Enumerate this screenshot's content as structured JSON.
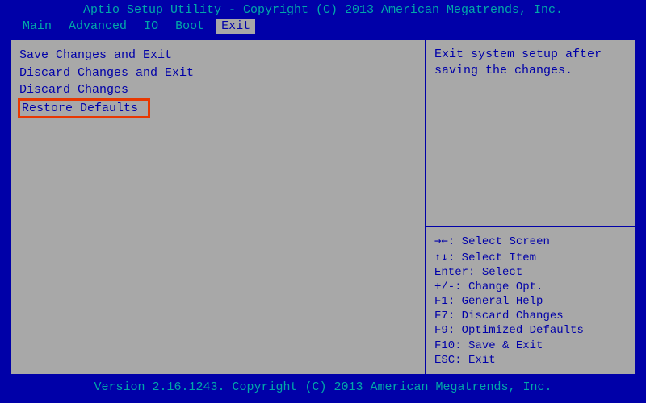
{
  "title": "Aptio Setup Utility - Copyright (C) 2013 American Megatrends, Inc.",
  "menu": {
    "items": [
      {
        "label": "Main"
      },
      {
        "label": "Advanced"
      },
      {
        "label": "IO"
      },
      {
        "label": "Boot"
      },
      {
        "label": "Exit"
      }
    ],
    "active_index": 4
  },
  "options": [
    {
      "label": "Save Changes and Exit"
    },
    {
      "label": "Discard Changes and Exit"
    },
    {
      "label": "Discard Changes"
    },
    {
      "label": "Restore Defaults"
    }
  ],
  "highlighted_index": 3,
  "help_text": "Exit system setup after saving the changes.",
  "key_hints": [
    {
      "key": "→←",
      "desc": "Select Screen"
    },
    {
      "key": "↑↓",
      "desc": "Select Item"
    },
    {
      "key": "Enter",
      "desc": "Select"
    },
    {
      "key": "+/-",
      "desc": "Change Opt."
    },
    {
      "key": "F1",
      "desc": "General Help"
    },
    {
      "key": "F7",
      "desc": "Discard Changes"
    },
    {
      "key": "F9",
      "desc": "Optimized Defaults"
    },
    {
      "key": "F10",
      "desc": "Save & Exit"
    },
    {
      "key": "ESC",
      "desc": "Exit"
    }
  ],
  "footer": "Version 2.16.1243. Copyright (C) 2013 American Megatrends, Inc."
}
